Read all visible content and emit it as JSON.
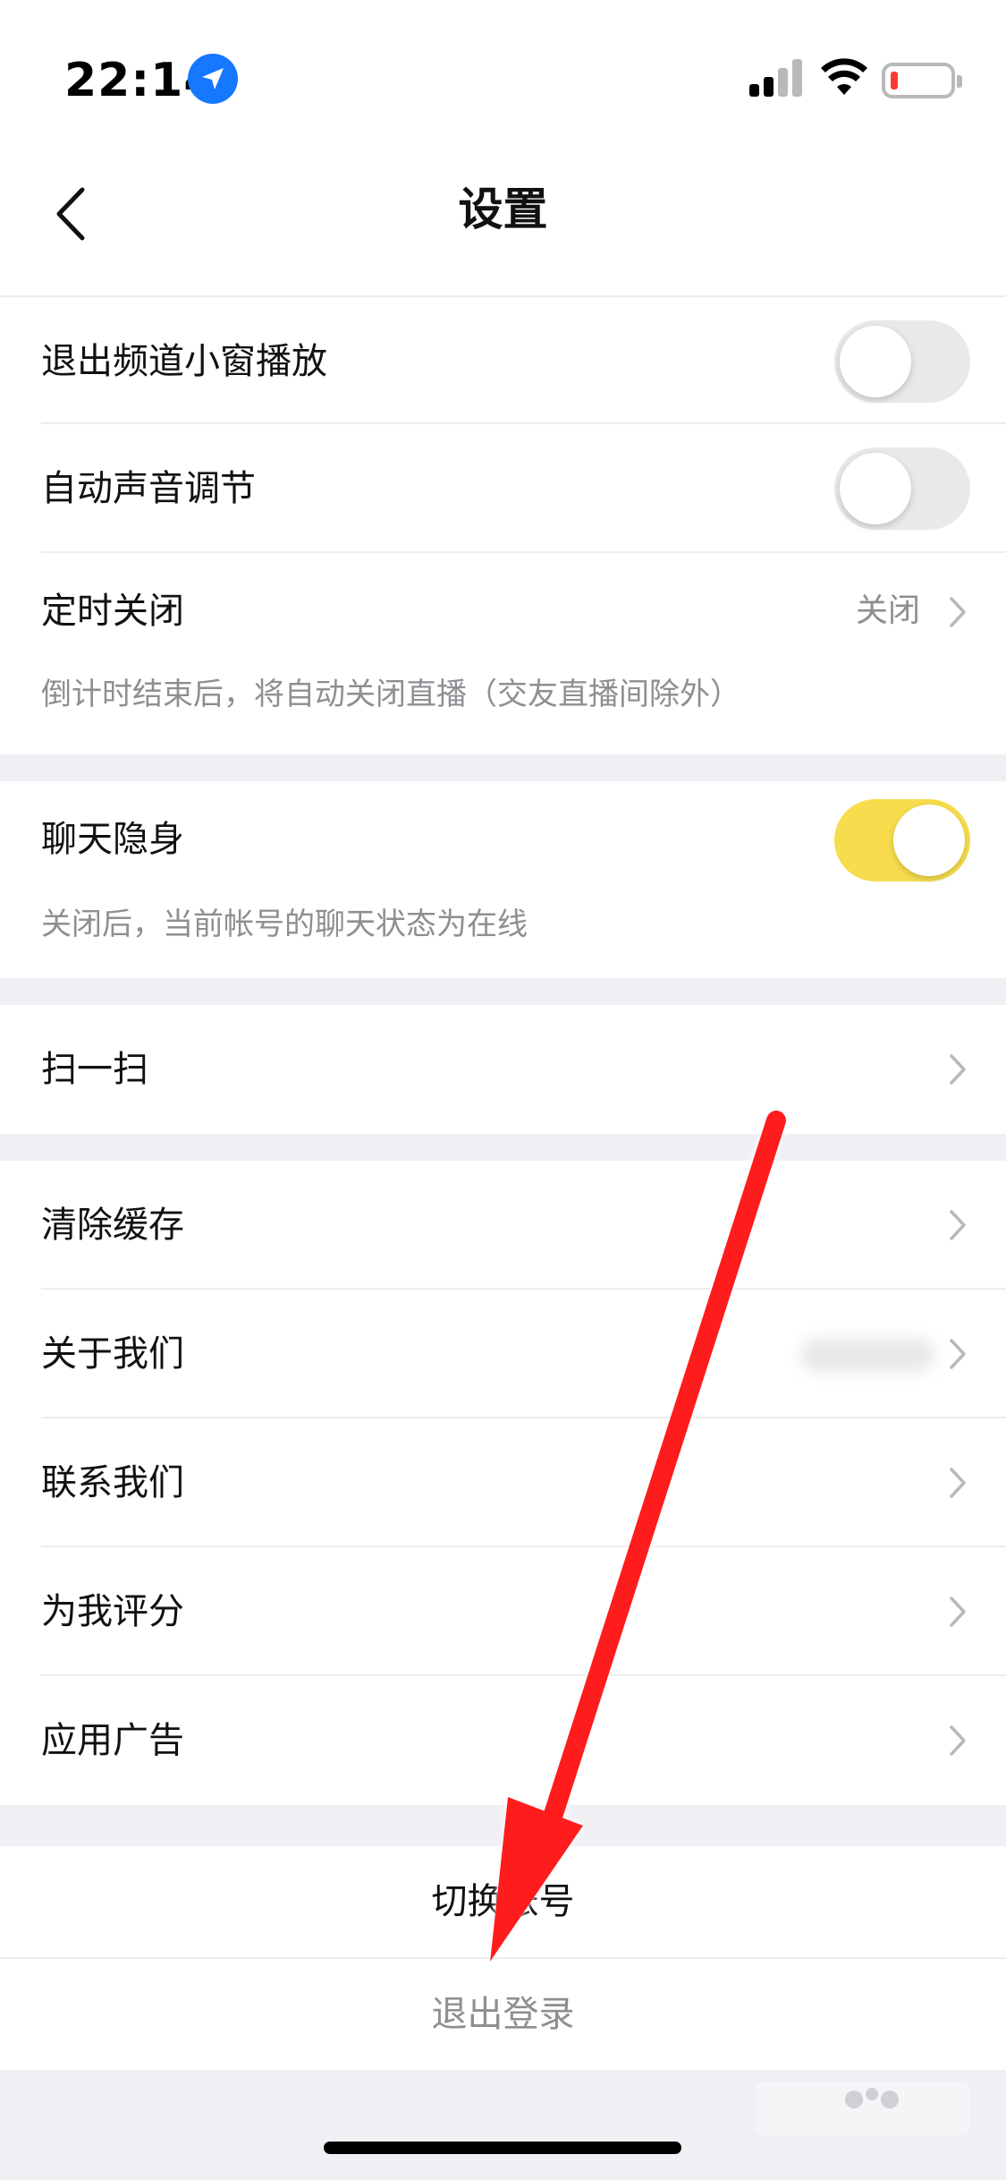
{
  "status": {
    "time": "22:14"
  },
  "nav": {
    "title": "设置"
  },
  "group1": {
    "items": [
      {
        "label": "退出频道小窗播放",
        "toggle": false
      },
      {
        "label": "自动声音调节",
        "toggle": false
      },
      {
        "label": "定时关闭",
        "value": "关闭",
        "desc": "倒计时结束后，将自动关闭直播（交友直播间除外）"
      }
    ]
  },
  "group2": {
    "label": "聊天隐身",
    "toggle": true,
    "desc": "关闭后，当前帐号的聊天状态为在线"
  },
  "group3": {
    "label": "扫一扫"
  },
  "group4": {
    "items": [
      "清除缓存",
      "关于我们",
      "联系我们",
      "为我评分",
      "应用广告"
    ]
  },
  "actions": {
    "switch_account": "切换账号",
    "logout": "退出登录"
  },
  "colors": {
    "toggle_on": "#f7dd4d",
    "annotation_arrow": "#ff1a1a",
    "location_icon": "#1677ff"
  }
}
